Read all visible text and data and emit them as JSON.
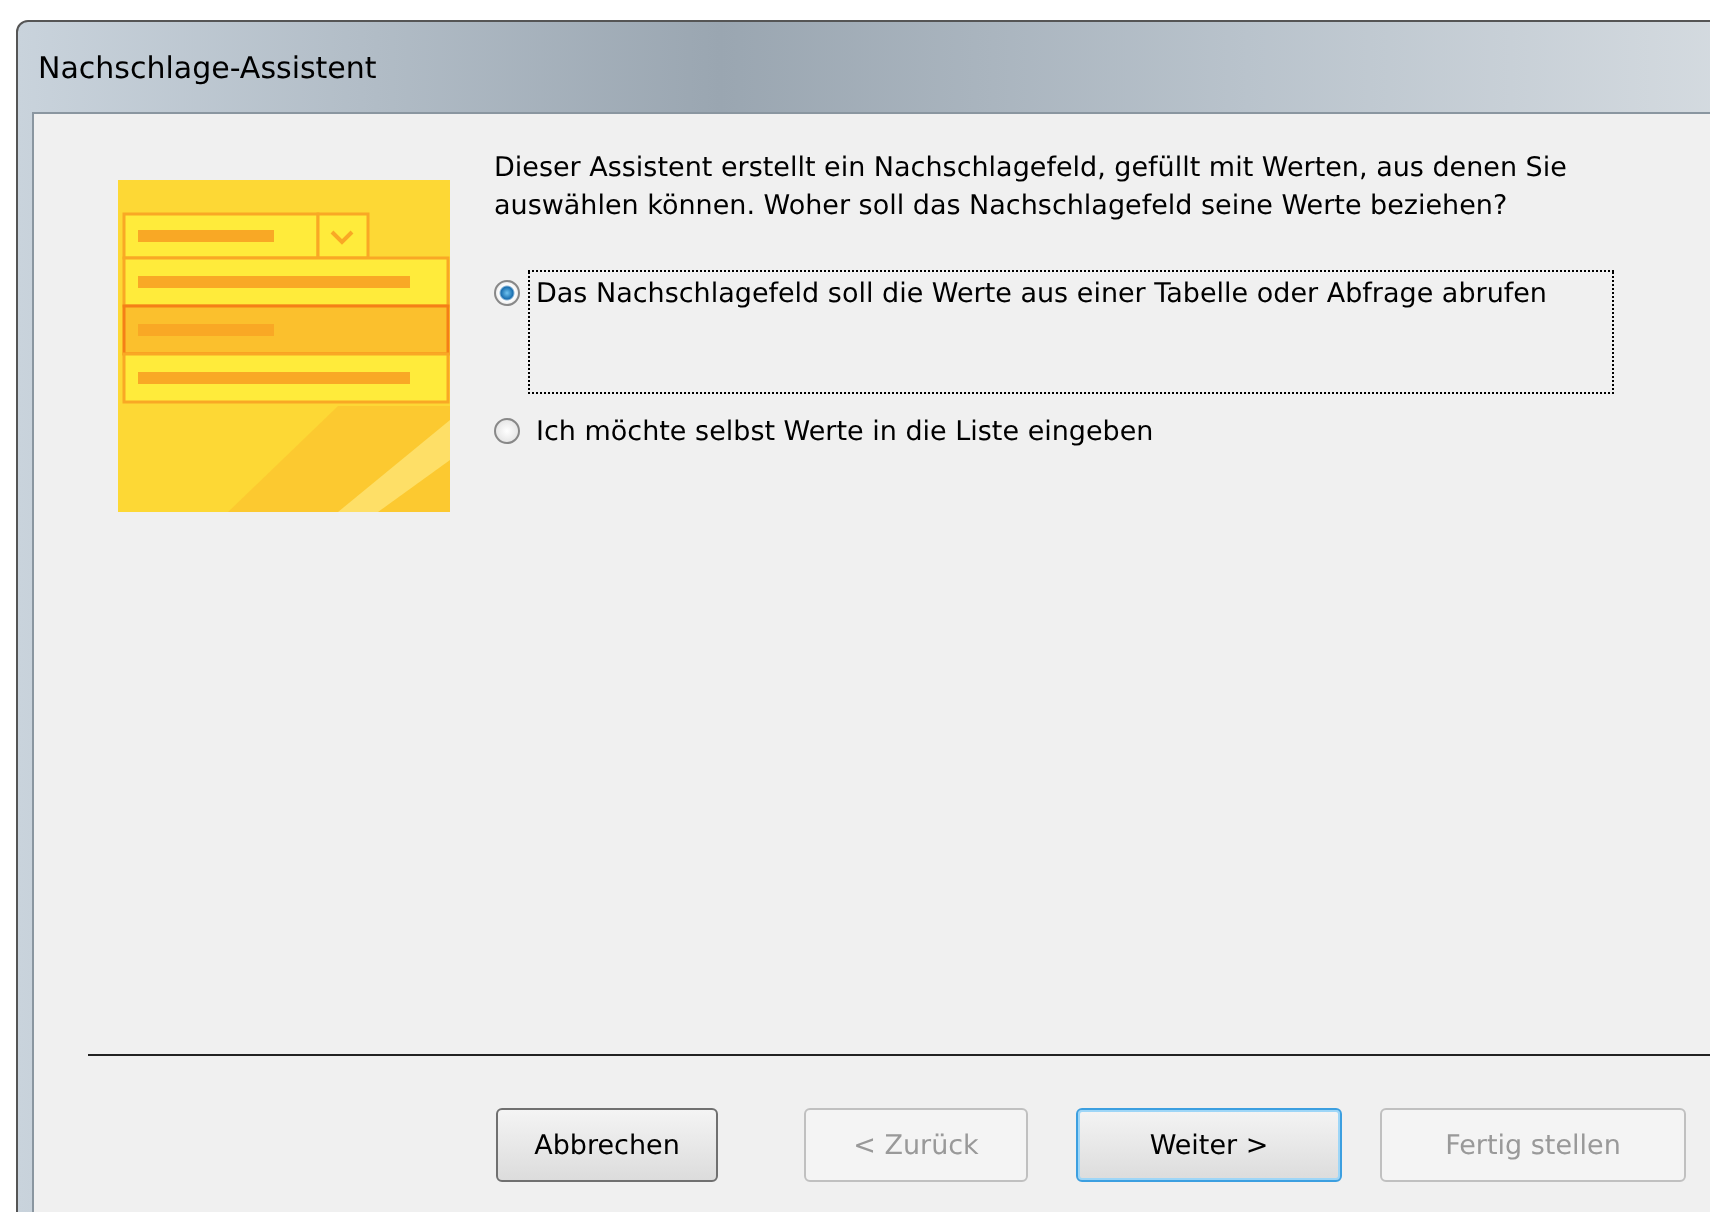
{
  "window": {
    "title": "Nachschlage-Assistent"
  },
  "intro": "Dieser Assistent erstellt ein Nachschlagefeld, gefüllt mit Werten, aus denen Sie auswählen können. Woher soll das Nachschlagefeld seine Werte beziehen?",
  "options": [
    {
      "label": "Das Nachschlagefeld soll die Werte aus einer Tabelle oder Abfrage abrufen",
      "selected": true
    },
    {
      "label": "Ich möchte selbst Werte in die Liste eingeben",
      "selected": false
    }
  ],
  "buttons": [
    {
      "label": "Abbrechen",
      "disabled": false,
      "default": false
    },
    {
      "label": "< Zurück",
      "disabled": true,
      "default": false
    },
    {
      "label": "Weiter >",
      "disabled": false,
      "default": true
    },
    {
      "label": "Fertig stellen",
      "disabled": true,
      "default": false
    }
  ]
}
